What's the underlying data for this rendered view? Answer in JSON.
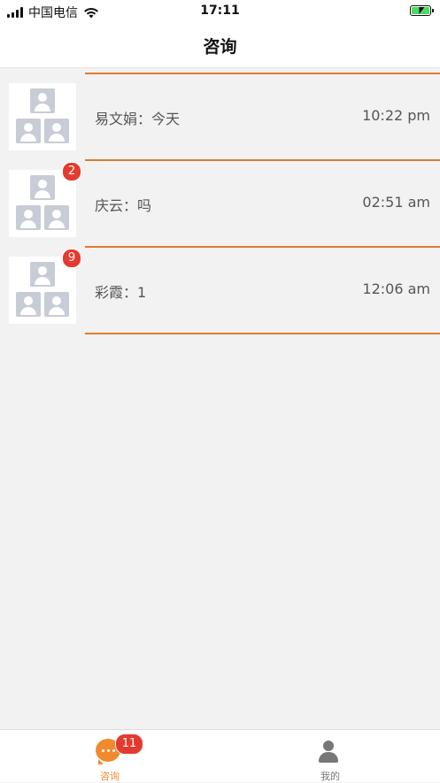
{
  "status_bar": {
    "carrier": "中国电信",
    "time": "17:11"
  },
  "nav": {
    "title": "咨询"
  },
  "conversations": [
    {
      "name": "易文娟",
      "message": "今天",
      "preview": "易文娟：今天",
      "time": "10:22 pm",
      "badge": ""
    },
    {
      "name": "庆云",
      "message": "吗",
      "preview": "庆云：吗",
      "time": "02:51 am",
      "badge": "2"
    },
    {
      "name": "彩霞",
      "message": "1",
      "preview": "彩霞：1",
      "time": "12:06 am",
      "badge": "9"
    }
  ],
  "tabbar": {
    "tabs": [
      {
        "label": "咨询",
        "badge": "11",
        "active": true,
        "icon": "chat-bubble-icon"
      },
      {
        "label": "我的",
        "badge": "",
        "active": false,
        "icon": "person-icon"
      }
    ]
  },
  "colors": {
    "accent": "#f08a2e",
    "separator": "#e07b2e",
    "badge": "#e53a2f",
    "background": "#f2f2f2"
  }
}
